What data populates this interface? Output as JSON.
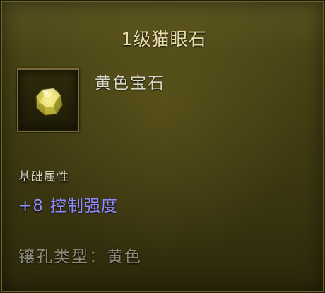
{
  "item": {
    "name": "1级猫眼石",
    "type": "黄色宝石",
    "icon": "yellow-gem-icon"
  },
  "attributes": {
    "header": "基础属性",
    "stat_value": "+8",
    "stat_name": "控制强度",
    "stat_color": "#8f8cff"
  },
  "socket": {
    "label": "镶孔类型：",
    "value": "黄色"
  },
  "colors": {
    "title": "#e9dca8",
    "panel": "#413c12",
    "gem": "#e8e06a"
  }
}
